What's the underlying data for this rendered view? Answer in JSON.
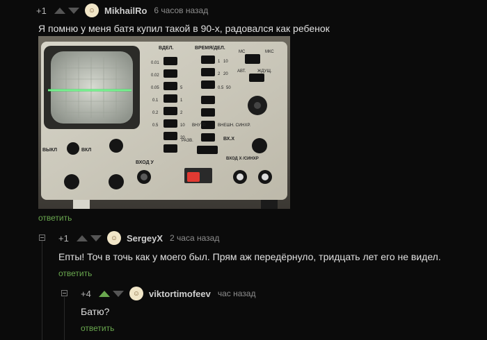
{
  "comments": [
    {
      "rating": "+1",
      "author": "MikhailRo",
      "time": "6 часов назад",
      "text": "Я помню у меня батя купил такой в 90-х, радовался как ребенок",
      "reply": "ответить",
      "image": {
        "panel_labels": {
          "v_div": "ВДЕЛ.",
          "time_div": "ВРЕМЯ/ДЕЛ.",
          "ms": "МС",
          "mks": "МКС",
          "avt": "АВТ.",
          "zhd": "ЖДУЩ.",
          "vnutr": "ВНУТР.",
          "vnesh": "ВНЕШН. СИНХР.",
          "razv": "РАЗВ.",
          "vkhx": "ВХ.X",
          "vykl": "ВЫКЛ",
          "vkl": "ВКЛ",
          "vkhod": "ВХОД У",
          "vkhodx": "ВХОД X /СИНХР"
        },
        "left_scale": [
          "0.01",
          "0.02",
          "0.05",
          "0.1",
          "0.2",
          "0.5"
        ],
        "right_scale_a": [
          "1",
          "2",
          "5",
          "10",
          "20"
        ],
        "right_scale_b": [
          "1",
          "2",
          "10",
          "20",
          "0.5",
          "50",
          "10"
        ]
      }
    },
    {
      "rating": "+1",
      "author": "SergeyX",
      "time": "2 часа назад",
      "text": "Епты! Точ в точь как у моего был. Прям аж передёрнуло, тридцать лет его не видел.",
      "reply": "ответить"
    },
    {
      "rating": "+4",
      "author": "viktortimofeev",
      "time": "час назад",
      "text": "Батю?",
      "reply": "ответить"
    }
  ]
}
